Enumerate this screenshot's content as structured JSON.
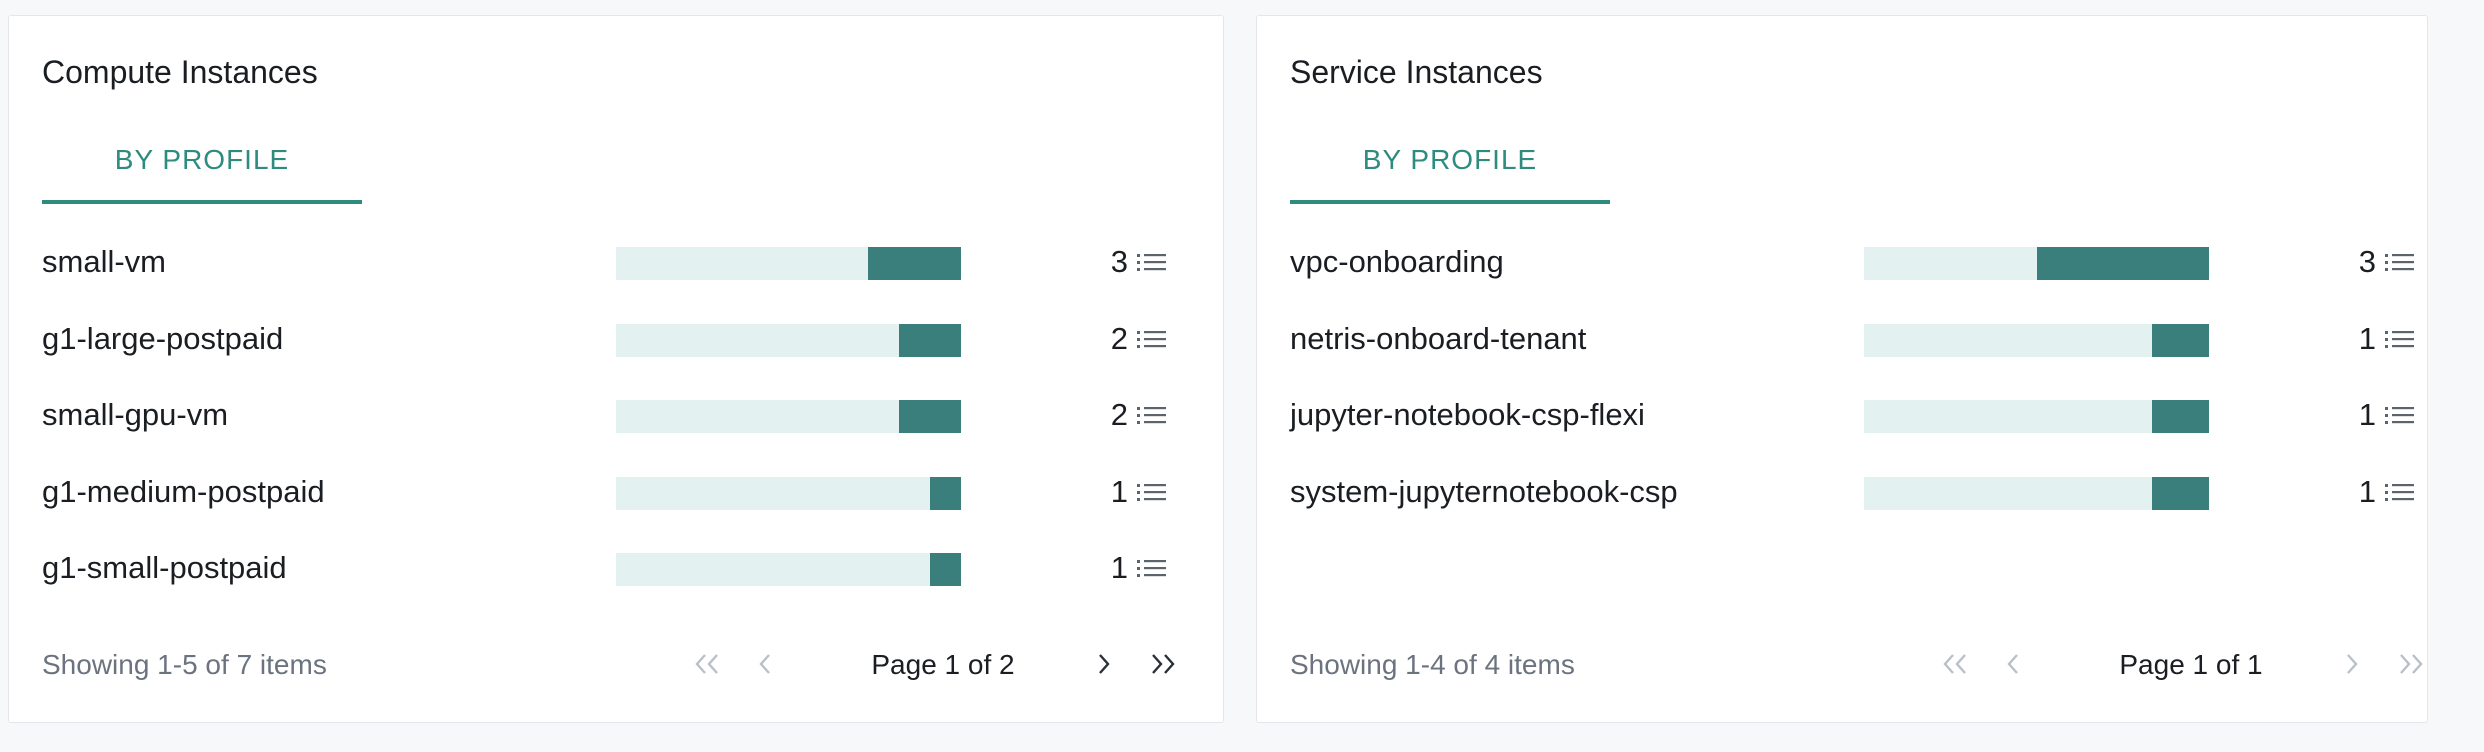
{
  "colors": {
    "accent": "#2e8b7e",
    "bar_fill": "#3a7f7c",
    "bar_track": "#e3f1f0",
    "muted_text": "#6b7380",
    "disabled_icon": "#b8c0c8",
    "active_icon": "#2a3038"
  },
  "compute": {
    "title": "Compute Instances",
    "tab": "BY PROFILE",
    "max_value": 3,
    "rows": [
      {
        "label": "small-vm",
        "count": "3",
        "value": 3
      },
      {
        "label": "g1-large-postpaid",
        "count": "2",
        "value": 2
      },
      {
        "label": "small-gpu-vm",
        "count": "2",
        "value": 2
      },
      {
        "label": "g1-medium-postpaid",
        "count": "1",
        "value": 1
      },
      {
        "label": "g1-small-postpaid",
        "count": "1",
        "value": 1
      }
    ],
    "footer": {
      "status": "Showing 1-5 of 7 items",
      "page": "Page 1 of 2",
      "first_enabled": false,
      "prev_enabled": false,
      "next_enabled": true,
      "last_enabled": true
    }
  },
  "service": {
    "title": "Service Instances",
    "tab": "BY PROFILE",
    "max_value": 3,
    "rows": [
      {
        "label": "vpc-onboarding",
        "count": "3",
        "value": 3
      },
      {
        "label": "netris-onboard-tenant",
        "count": "1",
        "value": 1
      },
      {
        "label": "jupyter-notebook-csp-flexi",
        "count": "1",
        "value": 1
      },
      {
        "label": "system-jupyternotebook-csp",
        "count": "1",
        "value": 1
      }
    ],
    "footer": {
      "status": "Showing 1-4 of 4 items",
      "page": "Page 1 of 1",
      "first_enabled": false,
      "prev_enabled": false,
      "next_enabled": false,
      "last_enabled": false
    }
  }
}
